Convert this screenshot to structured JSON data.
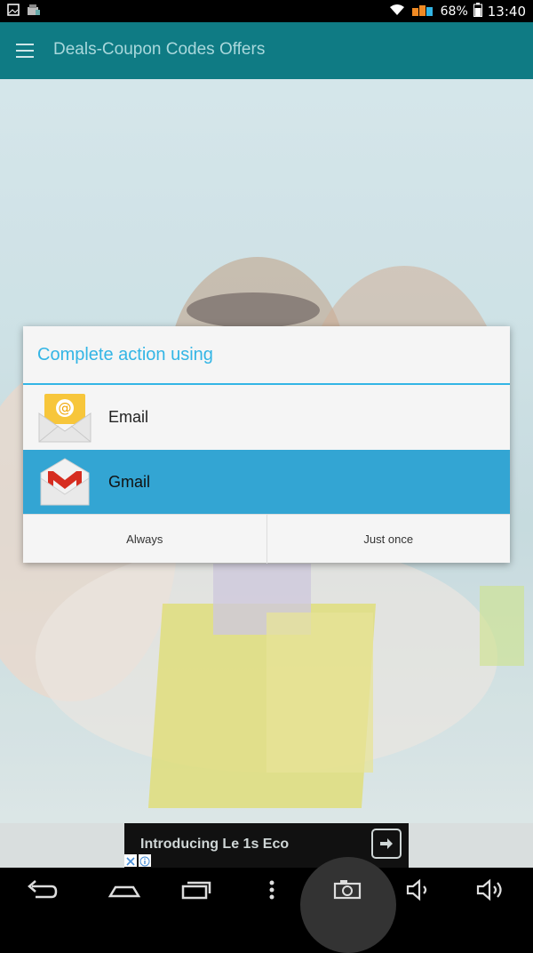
{
  "status_bar": {
    "battery_percent": "68%",
    "time": "13:40"
  },
  "app_bar": {
    "title": "Deals-Coupon Codes Offers"
  },
  "dialog": {
    "title": "Complete action using",
    "options": [
      {
        "label": "Email",
        "icon": "email-app-icon",
        "selected": false
      },
      {
        "label": "Gmail",
        "icon": "gmail-app-icon",
        "selected": true
      }
    ],
    "buttons": {
      "always": "Always",
      "just_once": "Just once"
    }
  },
  "ad": {
    "text": "Introducing Le 1s Eco"
  },
  "colors": {
    "app_bar": "#0f7b84",
    "accent": "#33b5e5",
    "selected_row": "#33a5d3"
  },
  "nav_bar": {
    "icons": [
      "back-icon",
      "home-icon",
      "recents-icon",
      "menu-dots-icon",
      "screenshot-icon",
      "volume-down-icon",
      "volume-up-icon"
    ]
  }
}
